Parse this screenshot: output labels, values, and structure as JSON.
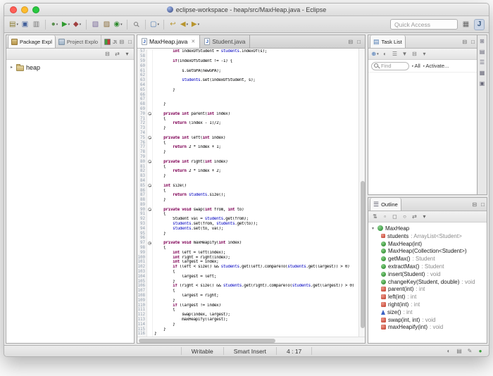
{
  "window": {
    "title": "eclipse-workspace - heap/src/MaxHeap.java - Eclipse"
  },
  "icons": {
    "dropdown": "▾",
    "minimize": "⊟",
    "maximize": "□",
    "close": "✕",
    "collapsed_arrow": "▸",
    "expanded_arrow": "▾",
    "task_list_glyph": "▤",
    "outline_glyph": "☰"
  },
  "toolbar": {
    "quick_access_placeholder": "Quick Access",
    "icons": [
      {
        "name": "new-wizard-icon",
        "glyph": "▤",
        "color": "#8a7a30",
        "dd": true
      },
      {
        "name": "save-icon",
        "glyph": "▣",
        "color": "#44619b"
      },
      {
        "name": "print-icon",
        "glyph": "▥",
        "color": "#777777"
      },
      {
        "sep": true
      },
      {
        "name": "debug-icon",
        "glyph": "●",
        "color": "#5a8f4e",
        "dd": true
      },
      {
        "name": "run-icon",
        "glyph": "▶",
        "color": "#2f9b2f",
        "dd": true
      },
      {
        "name": "external-tools-icon",
        "glyph": "◆",
        "color": "#a04040",
        "dd": true
      },
      {
        "sep": true
      },
      {
        "name": "new-java-project-icon",
        "glyph": "▧",
        "color": "#7a6a9a"
      },
      {
        "name": "new-package-icon",
        "glyph": "▨",
        "color": "#8a6d3b"
      },
      {
        "name": "new-class-icon",
        "glyph": "◉",
        "color": "#2f8b2f",
        "dd": true
      },
      {
        "sep": true
      },
      {
        "name": "search-icon",
        "glyph": "mag"
      },
      {
        "sep": true
      },
      {
        "name": "open-task-icon",
        "glyph": "▢",
        "color": "#4a77b0",
        "dd": true
      },
      {
        "sep": true
      },
      {
        "name": "last-edit-location-icon",
        "glyph": "↩",
        "color": "#b8952e"
      },
      {
        "name": "back-icon",
        "glyph": "◀",
        "color": "#b8952e",
        "dd": true
      },
      {
        "name": "forward-icon",
        "glyph": "▶",
        "color": "#b8952e",
        "dd": true
      }
    ]
  },
  "package_explorer": {
    "tabs": [
      {
        "label": "Package Expl",
        "icon": "pkg",
        "active": true
      },
      {
        "label": "Project Explo",
        "icon": "proj",
        "active": false
      },
      {
        "label": "JUnit",
        "icon": "junit",
        "active": false
      }
    ],
    "toolbar_icons": [
      {
        "name": "collapse-all-icon",
        "glyph": "⊟",
        "color": "#666666"
      },
      {
        "name": "link-with-editor-icon",
        "glyph": "⇄",
        "color": "#666666"
      },
      {
        "name": "view-menu-icon",
        "glyph": "▾",
        "color": "#666666"
      }
    ],
    "tree": [
      {
        "label": "heap"
      }
    ]
  },
  "editor": {
    "tabs": [
      {
        "label": "MaxHeap.java",
        "icon": "J",
        "active": true
      },
      {
        "label": "Student.java",
        "icon": "J",
        "active": false
      }
    ],
    "lines": [
      {
        "n": 57,
        "c": "        int indexOfStudent = students.indexOf(s);"
      },
      {
        "n": 58,
        "c": ""
      },
      {
        "n": 59,
        "c": "        if(indexOfStudent != -1) {"
      },
      {
        "n": 60,
        "c": ""
      },
      {
        "n": 61,
        "c": "            s.setGPA(newGPA);"
      },
      {
        "n": 62,
        "c": ""
      },
      {
        "n": 63,
        "c": "            students.set(indexOfStudent, s);"
      },
      {
        "n": 64,
        "c": ""
      },
      {
        "n": 65,
        "c": "        }"
      },
      {
        "n": 66,
        "c": ""
      },
      {
        "n": 67,
        "c": ""
      },
      {
        "n": 68,
        "c": "    }"
      },
      {
        "n": 69,
        "c": ""
      },
      {
        "n": 70,
        "c": "    private int parent(int index)",
        "f": 1
      },
      {
        "n": 71,
        "c": "    {"
      },
      {
        "n": 72,
        "c": "        return (index - 1)/2;"
      },
      {
        "n": 73,
        "c": "    }"
      },
      {
        "n": 74,
        "c": ""
      },
      {
        "n": 75,
        "c": "    private int left(int index)",
        "f": 1
      },
      {
        "n": 76,
        "c": "    {"
      },
      {
        "n": 77,
        "c": "        return 2 * index + 1;"
      },
      {
        "n": 78,
        "c": "    }"
      },
      {
        "n": 79,
        "c": ""
      },
      {
        "n": 80,
        "c": "    private int right(int index)",
        "f": 1
      },
      {
        "n": 81,
        "c": "    {"
      },
      {
        "n": 82,
        "c": "        return 2 * index + 2;"
      },
      {
        "n": 83,
        "c": "    }"
      },
      {
        "n": 84,
        "c": ""
      },
      {
        "n": 85,
        "c": "    int size()",
        "f": 1
      },
      {
        "n": 86,
        "c": "    {"
      },
      {
        "n": 87,
        "c": "        return students.size();"
      },
      {
        "n": 88,
        "c": "    }"
      },
      {
        "n": 89,
        "c": ""
      },
      {
        "n": 90,
        "c": "    private void swap(int from, int to)",
        "f": 1
      },
      {
        "n": 91,
        "c": "    {"
      },
      {
        "n": 92,
        "c": "        Student val = students.get(from);"
      },
      {
        "n": 93,
        "c": "        students.set(from, students.get(to));"
      },
      {
        "n": 94,
        "c": "        students.set(to, val);"
      },
      {
        "n": 95,
        "c": "    }"
      },
      {
        "n": 96,
        "c": ""
      },
      {
        "n": 97,
        "c": "    private void maxHeapify(int index)",
        "f": 1
      },
      {
        "n": 98,
        "c": "    {"
      },
      {
        "n": 99,
        "c": "        int left = left(index);"
      },
      {
        "n": 100,
        "c": "        int right = right(index);"
      },
      {
        "n": 101,
        "c": "        int largest = index;"
      },
      {
        "n": 102,
        "c": "        if (left < size() && students.get(left).compareTo(students.get(largest)) > 0)"
      },
      {
        "n": 103,
        "c": "        {"
      },
      {
        "n": 104,
        "c": "            largest = left;"
      },
      {
        "n": 105,
        "c": "        }"
      },
      {
        "n": 106,
        "c": "        if (right < size() && students.get(right).compareTo(students.get(largest)) > 0)"
      },
      {
        "n": 107,
        "c": "        {"
      },
      {
        "n": 108,
        "c": "            largest = right;"
      },
      {
        "n": 109,
        "c": "        }"
      },
      {
        "n": 110,
        "c": "        if (largest != index)"
      },
      {
        "n": 111,
        "c": "        {"
      },
      {
        "n": 112,
        "c": "            swap(index, largest);"
      },
      {
        "n": 113,
        "c": "            maxHeapify(largest);"
      },
      {
        "n": 114,
        "c": "        }"
      },
      {
        "n": 115,
        "c": "    }"
      },
      {
        "n": 116,
        "c": "}"
      }
    ]
  },
  "task_list": {
    "title": "Task List",
    "toolbar_icons": [
      {
        "name": "new-task-icon",
        "glyph": "⊕",
        "color": "#3a6db0",
        "dd": true
      },
      {
        "name": "hide-completed-icon",
        "glyph": "◐",
        "color": "#777777"
      },
      {
        "name": "group-by-icon",
        "glyph": "☰",
        "color": "#777777"
      },
      {
        "name": "filter-icon",
        "glyph": "▼",
        "color": "#777777"
      },
      {
        "name": "collapse-all-icon",
        "glyph": "⊟",
        "color": "#777777"
      },
      {
        "name": "view-menu-icon",
        "glyph": "▾",
        "color": "#777777"
      }
    ],
    "find_placeholder": "Find",
    "filter_all": "All",
    "filter_activate": "Activate..."
  },
  "trim_icons": [
    {
      "name": "restore-view-icon",
      "glyph": "⊞"
    },
    {
      "name": "minimized-view-icon",
      "glyph": "▤"
    },
    {
      "name": "minimized-view-icon",
      "glyph": "☰"
    },
    {
      "name": "minimized-view-icon",
      "glyph": "▦"
    },
    {
      "name": "minimized-view-icon",
      "glyph": "▣"
    }
  ],
  "outline": {
    "title": "Outline",
    "toolbar_icons": [
      {
        "name": "sort-icon",
        "glyph": "⇅",
        "color": "#666666"
      },
      {
        "name": "hide-fields-icon",
        "glyph": "▫",
        "color": "#666666"
      },
      {
        "name": "hide-static-icon",
        "glyph": "◻",
        "color": "#666666"
      },
      {
        "name": "hide-non-public-icon",
        "glyph": "○",
        "color": "#666666"
      },
      {
        "name": "link-with-editor-icon",
        "glyph": "⇄",
        "color": "#666666"
      },
      {
        "name": "view-menu-icon",
        "glyph": "▾",
        "color": "#666666"
      }
    ],
    "root": "MaxHeap",
    "members": [
      {
        "name": "students",
        "type": " : ArrayList<Student>",
        "icon": "field"
      },
      {
        "name": "MaxHeap(int)",
        "type": "",
        "icon": "pub"
      },
      {
        "name": "MaxHeap(Collection<Student>)",
        "type": "",
        "icon": "pub"
      },
      {
        "name": "getMax()",
        "type": " : Student",
        "icon": "pub"
      },
      {
        "name": "extractMax()",
        "type": " : Student",
        "icon": "pub"
      },
      {
        "name": "insert(Student)",
        "type": " : void",
        "icon": "pub"
      },
      {
        "name": "changeKey(Student, double)",
        "type": " : void",
        "icon": "pub"
      },
      {
        "name": "parent(int)",
        "type": " : int",
        "icon": "priv"
      },
      {
        "name": "left(int)",
        "type": " : int",
        "icon": "priv"
      },
      {
        "name": "right(int)",
        "type": " : int",
        "icon": "priv"
      },
      {
        "name": "size()",
        "type": " : int",
        "icon": "def"
      },
      {
        "name": "swap(int, int)",
        "type": " : void",
        "icon": "priv"
      },
      {
        "name": "maxHeapify(int)",
        "type": " : void",
        "icon": "priv"
      }
    ]
  },
  "statusbar": {
    "items": [
      "Writable",
      "Smart Insert",
      "4 : 17"
    ],
    "right_icons": [
      {
        "name": "statusbar-icon",
        "glyph": "◐",
        "color": "#777777"
      },
      {
        "name": "statusbar-icon",
        "glyph": "▤",
        "color": "#777777"
      },
      {
        "name": "statusbar-icon",
        "glyph": "✎",
        "color": "#777777"
      },
      {
        "name": "statusbar-icon",
        "glyph": "●",
        "color": "#3a9d3a"
      }
    ]
  }
}
